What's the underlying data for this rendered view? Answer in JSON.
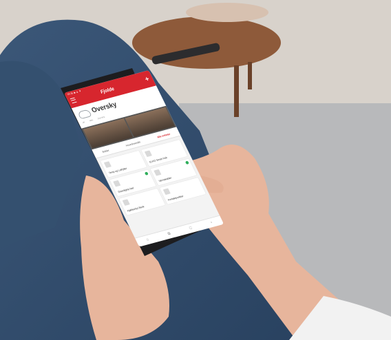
{
  "phone": {
    "status_bar": "09:35 ◆ ▲ ▼",
    "brand": "Fjolde",
    "page_title": "Oversky",
    "weather_metrics": [
      "18°",
      "45%",
      "1014 hPa"
    ],
    "tabs": [
      {
        "label": "Bolder",
        "active": false
      },
      {
        "label": "Hovedoversikt",
        "active": false
      },
      {
        "label": "Alle enheter",
        "active": true
      }
    ],
    "tiles": [
      {
        "label": "Temp og Luftfyller",
        "active": false
      },
      {
        "label": "ELKO Smart Hub",
        "active": false
      },
      {
        "label": "Downlights bad",
        "active": true
      },
      {
        "label": "Varmekabler",
        "active": true
      },
      {
        "label": "Kjøkkenlys Benk",
        "active": false
      },
      {
        "label": "Kontaktpunkter",
        "active": false
      }
    ],
    "nav": [
      "⌂",
      "⧉",
      "□",
      "‹"
    ]
  }
}
